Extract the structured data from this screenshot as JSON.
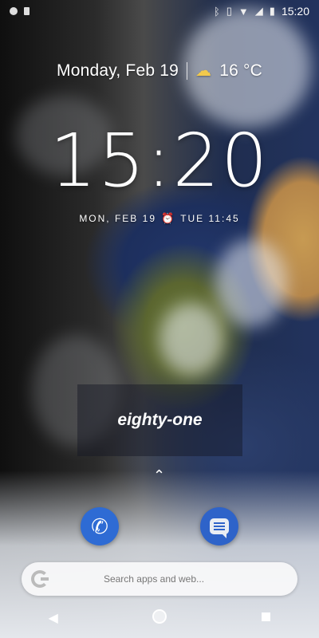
{
  "status_bar": {
    "time": "15:20",
    "left_icons": [
      "notification-dot-icon",
      "sd-card-icon"
    ],
    "right_icons": [
      "bluetooth-icon",
      "vibrate-icon",
      "wifi-icon",
      "signal-icon",
      "battery-charging-icon"
    ]
  },
  "header": {
    "date": "Monday, Feb 19",
    "weather_icon": "partly-cloudy-icon",
    "temperature": "16 °C"
  },
  "clock": {
    "time": "15:20",
    "date_short": "MON, FEB 19",
    "alarm_icon": "alarm-clock-icon",
    "next_alarm": "TUE 11:45"
  },
  "widget": {
    "word": "eighty-one"
  },
  "dock": {
    "apps": [
      {
        "name": "Phone",
        "icon": "phone-icon",
        "color": "#2e6bd4"
      },
      {
        "name": "Messages",
        "icon": "messages-icon",
        "color": "#2e63c9"
      }
    ],
    "expand_icon": "chevron-up-icon"
  },
  "search": {
    "placeholder": "Search apps and web...",
    "logo_icon": "google-g-icon"
  },
  "nav_bar": {
    "buttons": [
      "back-icon",
      "home-icon",
      "recents-icon"
    ]
  }
}
